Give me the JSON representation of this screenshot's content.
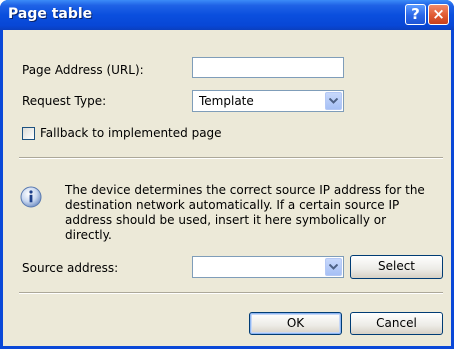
{
  "window": {
    "title": "Page table",
    "help_glyph": "?",
    "close_glyph": "×"
  },
  "form": {
    "page_address_label": "Page Address (URL):",
    "page_address_value": "",
    "request_type_label": "Request Type:",
    "request_type_value": "Template",
    "fallback_label": "Fallback to implemented page",
    "fallback_checked": false,
    "info_text": "The device determines the correct source IP address for the destination network automatically. If a certain source IP address should be used, insert it here symbolically or directly.",
    "source_address_label": "Source address:",
    "source_address_value": "",
    "select_button": "Select"
  },
  "footer": {
    "ok_button": "OK",
    "cancel_button": "Cancel"
  },
  "colors": {
    "titlebar": "#0a4fde",
    "dialog_bg": "#ece9d8",
    "input_border": "#7f9db9"
  },
  "icons": {
    "info": "info-icon",
    "dropdown": "chevron-down-icon"
  }
}
